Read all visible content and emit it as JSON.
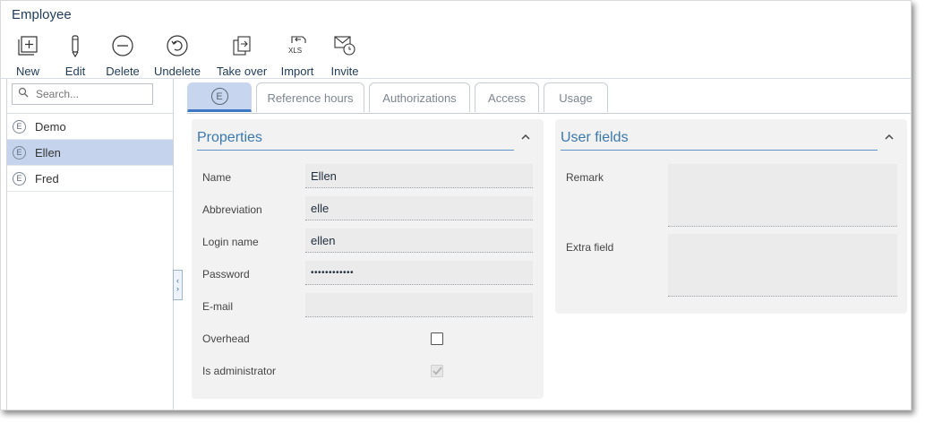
{
  "window": {
    "title": "Employee"
  },
  "toolbar": [
    {
      "label": "New",
      "icon": "new-icon"
    },
    {
      "label": "Edit",
      "icon": "pencil-icon"
    },
    {
      "label": "Delete",
      "icon": "minus-circle-icon"
    },
    {
      "label": "Undelete",
      "icon": "undo-circle-icon"
    },
    {
      "label": "Take over",
      "icon": "take-over-icon"
    },
    {
      "label": "Import",
      "icon": "xls-import-icon"
    },
    {
      "label": "Invite",
      "icon": "mail-clock-icon"
    }
  ],
  "sidebar": {
    "search_placeholder": "Search...",
    "items": [
      {
        "badge": "E",
        "label": "Demo",
        "selected": false
      },
      {
        "badge": "E",
        "label": "Ellen",
        "selected": true
      },
      {
        "badge": "E",
        "label": "Fred",
        "selected": false
      }
    ]
  },
  "tabs": [
    {
      "label": "E",
      "icon": "employee-badge-icon",
      "active": true
    },
    {
      "label": "Reference hours",
      "active": false
    },
    {
      "label": "Authorizations",
      "active": false
    },
    {
      "label": "Access",
      "active": false
    },
    {
      "label": "Usage",
      "active": false
    }
  ],
  "properties": {
    "title": "Properties",
    "fields": {
      "name": {
        "label": "Name",
        "value": "Ellen"
      },
      "abbreviation": {
        "label": "Abbreviation",
        "value": "elle"
      },
      "login": {
        "label": "Login name",
        "value": "ellen"
      },
      "password": {
        "label": "Password",
        "value": "••••••••••••"
      },
      "email": {
        "label": "E-mail",
        "value": ""
      },
      "overhead": {
        "label": "Overhead",
        "checked": false
      },
      "is_admin": {
        "label": "Is administrator",
        "checked": true,
        "disabled": true
      }
    }
  },
  "user_fields": {
    "title": "User fields",
    "remark": {
      "label": "Remark",
      "value": ""
    },
    "extra": {
      "label": "Extra field",
      "value": ""
    }
  },
  "colors": {
    "accent": "#3a78b0",
    "selected_row": "#c5d3ec",
    "active_tab": "#c7d6ee",
    "panel_bg": "#f2f2f2"
  }
}
